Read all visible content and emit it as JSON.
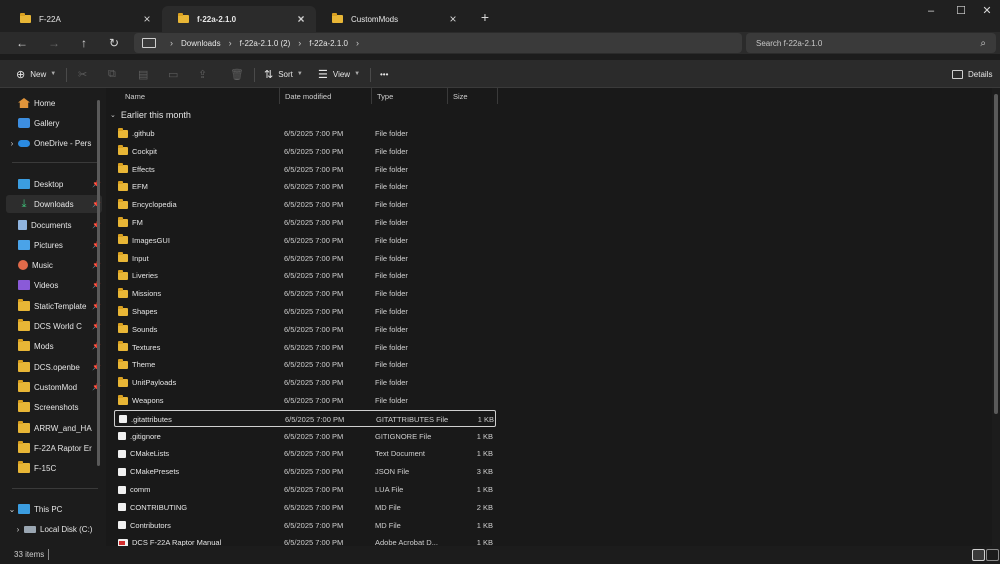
{
  "tabs": [
    {
      "title": "F-22A",
      "active": false
    },
    {
      "title": "f-22a-2.1.0",
      "active": true
    },
    {
      "title": "CustomMods",
      "active": false
    }
  ],
  "address": {
    "segments": [
      "Downloads",
      "f-22a-2.1.0 (2)",
      "f-22a-2.1.0"
    ]
  },
  "search": {
    "placeholder": "Search f-22a-2.1.0"
  },
  "toolbar": {
    "new_label": "New",
    "sort_label": "Sort",
    "view_label": "View",
    "more_label": "•••",
    "details_label": "Details"
  },
  "columns": {
    "name": "Name",
    "date": "Date modified",
    "type": "Type",
    "size": "Size"
  },
  "group": {
    "label": "Earlier this month"
  },
  "sidebar": {
    "items": [
      {
        "label": "Home",
        "icon": "home-icon"
      },
      {
        "label": "Gallery",
        "icon": "gallery-icon"
      },
      {
        "label": "OneDrive - Pers",
        "icon": "cloud-icon"
      },
      {
        "label": "Desktop",
        "icon": "desktop-icon"
      },
      {
        "label": "Downloads",
        "icon": "download-icon"
      },
      {
        "label": "Documents",
        "icon": "documents-icon"
      },
      {
        "label": "Pictures",
        "icon": "pictures-icon"
      },
      {
        "label": "Music",
        "icon": "music-icon"
      },
      {
        "label": "Videos",
        "icon": "videos-icon"
      },
      {
        "label": "StaticTemplate",
        "icon": "folder-icon"
      },
      {
        "label": "DCS World C",
        "icon": "folder-icon"
      },
      {
        "label": "Mods",
        "icon": "folder-icon"
      },
      {
        "label": "DCS.openbe",
        "icon": "folder-icon"
      },
      {
        "label": "CustomMod",
        "icon": "folder-icon"
      },
      {
        "label": "Screenshots",
        "icon": "folder-icon"
      },
      {
        "label": "ARRW_and_HA",
        "icon": "folder-icon"
      },
      {
        "label": "F-22A Raptor Er",
        "icon": "folder-icon"
      },
      {
        "label": "F-15C",
        "icon": "folder-icon"
      },
      {
        "label": "This PC",
        "icon": "pc-icon"
      },
      {
        "label": "Local Disk (C:)",
        "icon": "drive-icon"
      }
    ]
  },
  "files": [
    {
      "name": ".github",
      "date": "6/5/2025 7:00 PM",
      "type": "File folder",
      "size": "",
      "kind": "folder"
    },
    {
      "name": "Cockpit",
      "date": "6/5/2025 7:00 PM",
      "type": "File folder",
      "size": "",
      "kind": "folder"
    },
    {
      "name": "Effects",
      "date": "6/5/2025 7:00 PM",
      "type": "File folder",
      "size": "",
      "kind": "folder"
    },
    {
      "name": "EFM",
      "date": "6/5/2025 7:00 PM",
      "type": "File folder",
      "size": "",
      "kind": "folder"
    },
    {
      "name": "Encyclopedia",
      "date": "6/5/2025 7:00 PM",
      "type": "File folder",
      "size": "",
      "kind": "folder"
    },
    {
      "name": "FM",
      "date": "6/5/2025 7:00 PM",
      "type": "File folder",
      "size": "",
      "kind": "folder"
    },
    {
      "name": "ImagesGUI",
      "date": "6/5/2025 7:00 PM",
      "type": "File folder",
      "size": "",
      "kind": "folder"
    },
    {
      "name": "Input",
      "date": "6/5/2025 7:00 PM",
      "type": "File folder",
      "size": "",
      "kind": "folder"
    },
    {
      "name": "Liveries",
      "date": "6/5/2025 7:00 PM",
      "type": "File folder",
      "size": "",
      "kind": "folder"
    },
    {
      "name": "Missions",
      "date": "6/5/2025 7:00 PM",
      "type": "File folder",
      "size": "",
      "kind": "folder"
    },
    {
      "name": "Shapes",
      "date": "6/5/2025 7:00 PM",
      "type": "File folder",
      "size": "",
      "kind": "folder"
    },
    {
      "name": "Sounds",
      "date": "6/5/2025 7:00 PM",
      "type": "File folder",
      "size": "",
      "kind": "folder"
    },
    {
      "name": "Textures",
      "date": "6/5/2025 7:00 PM",
      "type": "File folder",
      "size": "",
      "kind": "folder"
    },
    {
      "name": "Theme",
      "date": "6/5/2025 7:00 PM",
      "type": "File folder",
      "size": "",
      "kind": "folder"
    },
    {
      "name": "UnitPayloads",
      "date": "6/5/2025 7:00 PM",
      "type": "File folder",
      "size": "",
      "kind": "folder"
    },
    {
      "name": "Weapons",
      "date": "6/5/2025 7:00 PM",
      "type": "File folder",
      "size": "",
      "kind": "folder"
    },
    {
      "name": ".gitattributes",
      "date": "6/5/2025 7:00 PM",
      "type": "GITATTRIBUTES File",
      "size": "1 KB",
      "kind": "file"
    },
    {
      "name": ".gitignore",
      "date": "6/5/2025 7:00 PM",
      "type": "GITIGNORE File",
      "size": "1 KB",
      "kind": "file"
    },
    {
      "name": "CMakeLists",
      "date": "6/5/2025 7:00 PM",
      "type": "Text Document",
      "size": "1 KB",
      "kind": "file"
    },
    {
      "name": "CMakePresets",
      "date": "6/5/2025 7:00 PM",
      "type": "JSON File",
      "size": "3 KB",
      "kind": "file"
    },
    {
      "name": "comm",
      "date": "6/5/2025 7:00 PM",
      "type": "LUA File",
      "size": "1 KB",
      "kind": "file"
    },
    {
      "name": "CONTRIBUTING",
      "date": "6/5/2025 7:00 PM",
      "type": "MD File",
      "size": "2 KB",
      "kind": "file"
    },
    {
      "name": "Contributors",
      "date": "6/5/2025 7:00 PM",
      "type": "MD File",
      "size": "1 KB",
      "kind": "file"
    },
    {
      "name": "DCS F-22A Raptor Manual",
      "date": "6/5/2025 7:00 PM",
      "type": "Adobe Acrobat D...",
      "size": "1 KB",
      "kind": "pdf"
    }
  ],
  "status": {
    "item_count": "33 items"
  }
}
